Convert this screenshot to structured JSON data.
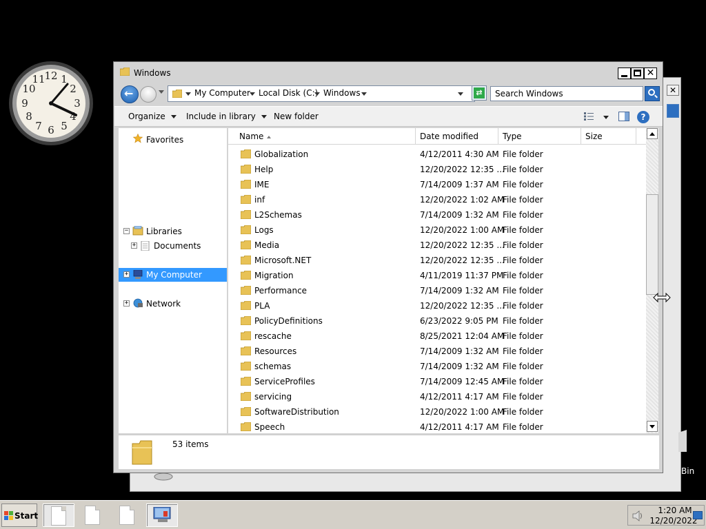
{
  "desktop": {
    "recycle_bin_label": "Bin"
  },
  "window": {
    "title": "Windows",
    "minimize_label": "minimize",
    "maximize_label": "maximize",
    "close_label": "✕"
  },
  "address_bar": {
    "crumbs": [
      "My Computer",
      "Local Disk (C:)",
      "Windows"
    ],
    "search_placeholder": "Search Windows"
  },
  "toolbar": {
    "organize": "Organize",
    "include_in_library": "Include in library",
    "new_folder": "New folder"
  },
  "nav_pane": {
    "favorites": "Favorites",
    "libraries": "Libraries",
    "documents": "Documents",
    "my_computer": "My Computer",
    "network": "Network"
  },
  "columns": {
    "name": "Name",
    "date_modified": "Date modified",
    "type": "Type",
    "size": "Size"
  },
  "files": [
    {
      "name": "Globalization",
      "date": "4/12/2011 4:30 AM",
      "type": "File folder"
    },
    {
      "name": "Help",
      "date": "12/20/2022 12:35 ...",
      "type": "File folder"
    },
    {
      "name": "IME",
      "date": "7/14/2009 1:37 AM",
      "type": "File folder"
    },
    {
      "name": "inf",
      "date": "12/20/2022 1:02 AM",
      "type": "File folder"
    },
    {
      "name": "L2Schemas",
      "date": "7/14/2009 1:32 AM",
      "type": "File folder"
    },
    {
      "name": "Logs",
      "date": "12/20/2022 1:00 AM",
      "type": "File folder"
    },
    {
      "name": "Media",
      "date": "12/20/2022 12:35 ...",
      "type": "File folder"
    },
    {
      "name": "Microsoft.NET",
      "date": "12/20/2022 12:35 ...",
      "type": "File folder"
    },
    {
      "name": "Migration",
      "date": "4/11/2019 11:37 PM",
      "type": "File folder"
    },
    {
      "name": "Performance",
      "date": "7/14/2009 1:32 AM",
      "type": "File folder"
    },
    {
      "name": "PLA",
      "date": "12/20/2022 12:35 ...",
      "type": "File folder"
    },
    {
      "name": "PolicyDefinitions",
      "date": "6/23/2022 9:05 PM",
      "type": "File folder"
    },
    {
      "name": "rescache",
      "date": "8/25/2021 12:04 AM",
      "type": "File folder"
    },
    {
      "name": "Resources",
      "date": "7/14/2009 1:32 AM",
      "type": "File folder"
    },
    {
      "name": "schemas",
      "date": "7/14/2009 1:32 AM",
      "type": "File folder"
    },
    {
      "name": "ServiceProfiles",
      "date": "7/14/2009 12:45 AM",
      "type": "File folder"
    },
    {
      "name": "servicing",
      "date": "4/12/2011 4:17 AM",
      "type": "File folder"
    },
    {
      "name": "SoftwareDistribution",
      "date": "12/20/2022 1:00 AM",
      "type": "File folder"
    },
    {
      "name": "Speech",
      "date": "4/12/2011 4:17 AM",
      "type": "File folder"
    }
  ],
  "details": {
    "item_count": "53 items"
  },
  "taskbar": {
    "start_label": "Start",
    "time": "1:20 AM",
    "date": "12/20/2022"
  },
  "colors": {
    "selection": "#3399ff",
    "folder": "#e8c256",
    "accent": "#2d6fc0"
  },
  "icons": {
    "window_icon": "folder-icon",
    "back": "back-arrow-icon",
    "forward": "forward-arrow-icon",
    "refresh": "refresh-icon",
    "search": "search-icon",
    "favorites": "star-icon",
    "libraries": "libraries-icon",
    "documents": "documents-icon",
    "computer": "computer-icon",
    "network": "network-icon",
    "help": "help-icon",
    "speaker": "speaker-icon",
    "clock": "clock-gadget"
  }
}
